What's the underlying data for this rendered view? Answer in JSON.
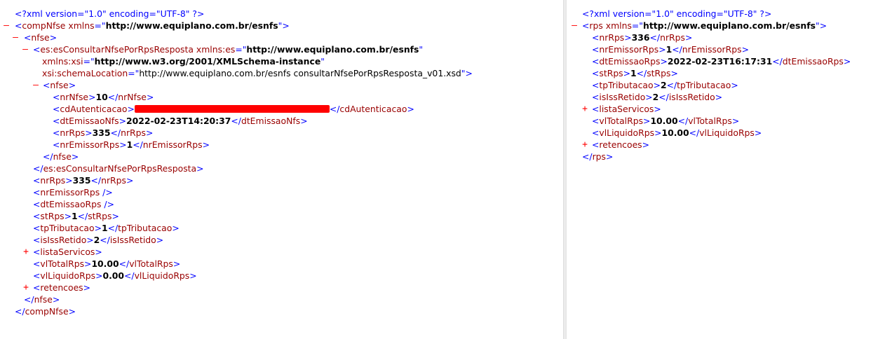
{
  "left": {
    "pi": {
      "name": "xml",
      "attrs": [
        {
          "name": "version",
          "value": "1.0"
        },
        {
          "name": "encoding",
          "value": "UTF-8"
        }
      ]
    },
    "tog_minus": "–",
    "tog_plus": "+",
    "compNfse": {
      "tag": "compNfse",
      "xmlns_attr": "xmlns",
      "xmlns_value": "http://www.equiplano.com.br/esnfs"
    },
    "nfse_outer": {
      "tag": "nfse"
    },
    "resposta": {
      "tag": "es:esConsultarNfsePorRpsResposta",
      "attr1_name": "xmlns:es",
      "attr1_value": "http://www.equiplano.com.br/esnfs",
      "attr2_name": "xmlns:xsi",
      "attr2_value": "http://www.w3.org/2001/XMLSchema-instance",
      "attr3_name": "xsi:schemaLocation",
      "attr3_value": "http://www.equiplano.com.br/esnfs consultarNfsePorRpsResposta_v01.xsd"
    },
    "nfse_inner": {
      "tag": "nfse",
      "nrNfse": {
        "tag": "nrNfse",
        "value": "10"
      },
      "cdAutenticacao": {
        "tag": "cdAutenticacao"
      },
      "dtEmissaoNfs": {
        "tag": "dtEmissaoNfs",
        "value": "2022-02-23T14:20:37"
      },
      "nrRps": {
        "tag": "nrRps",
        "value": "335"
      },
      "nrEmissorRps": {
        "tag": "nrEmissorRps",
        "value": "1"
      }
    },
    "fields": {
      "nrRps": {
        "tag": "nrRps",
        "value": "335"
      },
      "nrEmissorRps": {
        "tag": "nrEmissorRps"
      },
      "dtEmissaoRps": {
        "tag": "dtEmissaoRps"
      },
      "stRps": {
        "tag": "stRps",
        "value": "1"
      },
      "tpTributacao": {
        "tag": "tpTributacao",
        "value": "1"
      },
      "isIssRetido": {
        "tag": "isIssRetido",
        "value": "2"
      },
      "listaServicos": {
        "tag": "listaServicos"
      },
      "vlTotalRps": {
        "tag": "vlTotalRps",
        "value": "10.00"
      },
      "vlLiquidoRps": {
        "tag": "vlLiquidoRps",
        "value": "0.00"
      },
      "retencoes": {
        "tag": "retencoes"
      }
    }
  },
  "right": {
    "pi": {
      "name": "xml",
      "attrs": [
        {
          "name": "version",
          "value": "1.0"
        },
        {
          "name": "encoding",
          "value": "UTF-8"
        }
      ]
    },
    "tog_minus": "–",
    "tog_plus": "+",
    "rps": {
      "tag": "rps",
      "xmlns_attr": "xmlns",
      "xmlns_value": "http://www.equiplano.com.br/esnfs"
    },
    "fields": {
      "nrRps": {
        "tag": "nrRps",
        "value": "336"
      },
      "nrEmissorRps": {
        "tag": "nrEmissorRps",
        "value": "1"
      },
      "dtEmissaoRps": {
        "tag": "dtEmissaoRps",
        "value": "2022-02-23T16:17:31"
      },
      "stRps": {
        "tag": "stRps",
        "value": "1"
      },
      "tpTributacao": {
        "tag": "tpTributacao",
        "value": "2"
      },
      "isIssRetido": {
        "tag": "isIssRetido",
        "value": "2"
      },
      "listaServicos": {
        "tag": "listaServicos"
      },
      "vlTotalRps": {
        "tag": "vlTotalRps",
        "value": "10.00"
      },
      "vlLiquidoRps": {
        "tag": "vlLiquidoRps",
        "value": "10.00"
      },
      "retencoes": {
        "tag": "retencoes"
      }
    }
  }
}
